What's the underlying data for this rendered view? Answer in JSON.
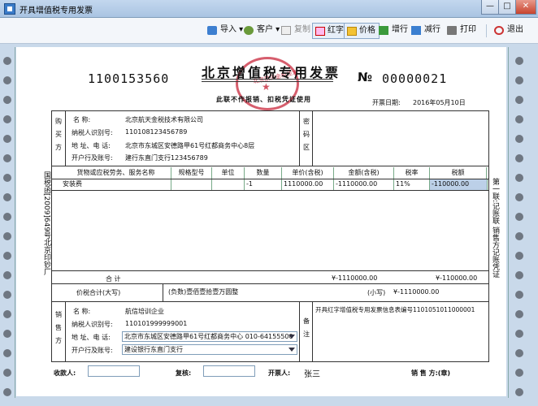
{
  "window": {
    "title": "开具增值税专用发票",
    "min": "—",
    "max": "□",
    "close": "✕"
  },
  "toolbar": {
    "import": "导入",
    "customer": "客户",
    "copy": "复制",
    "red": "红字",
    "price": "价格",
    "add_row": "增行",
    "remove_row": "减行",
    "print": "打印",
    "exit": "退出"
  },
  "invoice": {
    "code": "1100153560",
    "title": "北京增值税专用发票",
    "subtitle": "此联不作报销、扣税凭证使用",
    "no_sign": "№",
    "number": "00000021",
    "date_label": "开票日期:",
    "date": "2016年05月10日",
    "seal_text": "北京航天金税技术",
    "seal_star": "★",
    "side_left": "国税函[2009]649号北京印钞厂",
    "side_right": "第一联:记账联 销售方记账凭证"
  },
  "buyer": {
    "section": "购买方",
    "name_label": "名 称:",
    "name": "北京航天金税技术有限公司",
    "tax_label": "纳税人识别号:",
    "tax_id": "110108123456789",
    "addr_label": "地 址、电 话:",
    "addr": "北京市东城区安德路甲61号红都商务中心8层",
    "bank_label": "开户行及账号:",
    "bank": "建行东直门支行123456789",
    "cipher_label": "密码区"
  },
  "table": {
    "headers": [
      "货物或应税劳务、服务名称",
      "规格型号",
      "单位",
      "数量",
      "单价(含税)",
      "金额(含税)",
      "税率",
      "税额"
    ],
    "rows": [
      [
        "安装费",
        "",
        "",
        "-1",
        "1110000.00",
        "-1110000.00",
        "11%",
        "-110000.00"
      ]
    ]
  },
  "totals": {
    "label": "合 计",
    "amount": "¥-1110000.00",
    "tax": "¥-110000.00",
    "total_label": "价税合计(大写)",
    "total_words": "(负数)壹佰壹拾壹万圆整",
    "small_label": "(小写)",
    "total_small": "¥-1110000.00"
  },
  "seller": {
    "section": "销售方",
    "name_label": "名 称:",
    "name": "航信培训企业",
    "tax_label": "纳税人识别号:",
    "tax_id": "110101999999001",
    "addr_label": "地 址、电 话:",
    "addr": "北京市东城区安德路甲61号红都商务中心 010-64155500",
    "bank_label": "开户行及账号:",
    "bank": "建设银行东直门支行",
    "remark_label": "备注",
    "remark": "开具红字增值税专用发票信息表编号1101051011000001"
  },
  "footer": {
    "payee_label": "收款人:",
    "payee": "",
    "review_label": "复核:",
    "review": "",
    "drawer_label": "开票人:",
    "drawer": "张三",
    "seller_label": "销 售 方:(章)"
  }
}
